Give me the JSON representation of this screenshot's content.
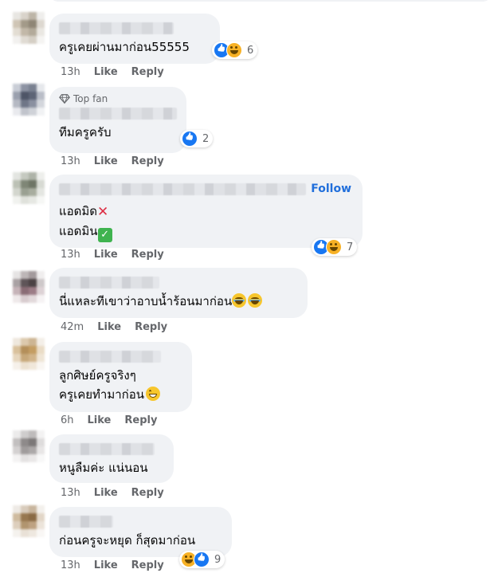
{
  "labels": {
    "like": "Like",
    "reply": "Reply",
    "follow": "Follow",
    "top_fan": "Top fan"
  },
  "comments": [
    {
      "text": "ครูเคยผ่านมาก่อน55555",
      "time": "13h",
      "reaction_count": "6"
    },
    {
      "text": "ทีมครูครับ",
      "time": "13h",
      "reaction_count": "2",
      "badge": "Top fan"
    },
    {
      "text_line1": "แอดมิด",
      "text_line2": "แอดมิน",
      "time": "13h",
      "reaction_count": "7",
      "action": "Follow"
    },
    {
      "text": "นี่แหละทีเขาว่าอาบน้ำร้อนมาก่อน",
      "time": "42m"
    },
    {
      "text_line1": "ลูกศิษย์ครูจริงๆ",
      "text_line2": "ครูเคยทำมาก่อน",
      "time": "6h"
    },
    {
      "text": "หนูลืมค่ะ แน่นอน",
      "time": "13h"
    },
    {
      "text": "ก่อนครูจะหยุด ก็สุดมาก่อน",
      "time": "13h",
      "reaction_count": "9"
    }
  ],
  "colors": {
    "bubble": "#f0f2f5",
    "link": "#216fdb",
    "meta": "#65676b",
    "like_blue": "#1877f2",
    "haha_yellow": "#f7b125"
  }
}
